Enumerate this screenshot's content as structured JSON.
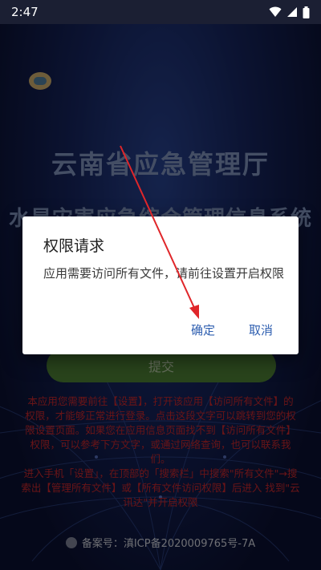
{
  "status_bar": {
    "time": "2:47",
    "icons": [
      "wifi-icon",
      "signal-icon",
      "battery-icon"
    ]
  },
  "app": {
    "title_main": "云南省应急管理厅",
    "title_sub": "水旱灾害应急综合管理信息系统",
    "submit_label": "提交",
    "notice_lines": [
      "本应用您需要前往【设置】，打开该应用【访问所有文件】的",
      "权限，才能够正常进行登录。点击这段文字可以跳转到您的权",
      "限设置页面。如果您在应用信息页面找不到【访问所有文件】",
      "权限，可以参考下方文字，或通过网络查询，也可以联系我",
      "们。",
      "进入手机「设置」，在顶部的「搜索栏」中搜索\"所有文件\"→搜",
      "索出【管理所有文件】或【所有文件访问权限】后进入 找到\"云",
      "讯达\"并开启权限"
    ],
    "icp_text": "备案号：滇ICP备2020009765号-7A"
  },
  "dialog": {
    "title": "权限请求",
    "message": "应用需要访问所有文件，请前往设置开启权限",
    "ok_label": "确定",
    "cancel_label": "取消"
  },
  "colors": {
    "accent_button": "#2f5fb0",
    "notice_text": "#c0262a",
    "annotation_arrow": "#e0262a"
  }
}
